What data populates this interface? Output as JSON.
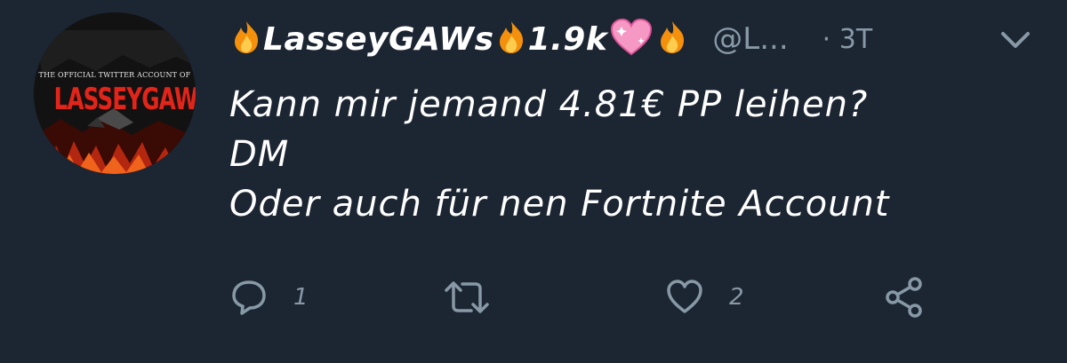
{
  "tweet": {
    "display_name": "LasseyGAWs",
    "follower_count": "1.9k",
    "handle": "@L...",
    "timestamp": "· 3T",
    "text_lines": [
      "Kann mir jemand 4.81€ PP leihen?",
      "DM",
      "Oder auch für nen Fortnite Account"
    ]
  },
  "avatar": {
    "subtitle": "THE OFFICIAL TWITTER ACCOUNT OF",
    "name": "LASSEYGAWS"
  },
  "actions": {
    "reply_count": "1",
    "retweet_count": "",
    "like_count": "2"
  },
  "icons": {
    "name_decoration": "fire-emoji",
    "count_decoration": "sparkling-heart-emoji",
    "reply": "speech-bubble-icon",
    "retweet": "retweet-arrows-icon",
    "like": "heart-outline-icon",
    "share": "share-nodes-icon",
    "menu": "chevron-down-icon"
  },
  "colors": {
    "background": "#1c2532",
    "text": "#ffffff",
    "muted": "#8899a6",
    "avatar_accent": "#e0261b"
  }
}
